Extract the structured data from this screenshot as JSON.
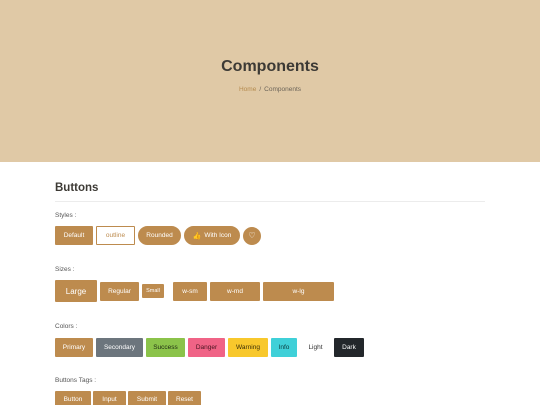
{
  "hero": {
    "title": "Components",
    "breadcrumb": {
      "home": "Home",
      "separator": "/",
      "current": "Components"
    }
  },
  "section": {
    "title": "Buttons"
  },
  "styles": {
    "label": "Styles :",
    "default": "Default",
    "outline": "outline",
    "rounded": "Rounded",
    "with_icon": "With Icon",
    "with_icon_glyph": "👍",
    "heart_glyph": "♡"
  },
  "sizes": {
    "label": "Sizes :",
    "large": "Large",
    "regular": "Regular",
    "small": "Small",
    "w_sm": "w-sm",
    "w_md": "w-md",
    "w_lg": "w-lg"
  },
  "colors": {
    "label": "Colors :",
    "items": [
      "Primary",
      "Secondary",
      "Success",
      "Danger",
      "Warning",
      "Info",
      "Light",
      "Dark"
    ],
    "accent": "#bd8b4e",
    "hero_bg": "#e0c9a6"
  },
  "tags": {
    "label": "Buttons Tags :",
    "items": [
      "Button",
      "Input",
      "Submit",
      "Reset"
    ]
  },
  "icons": {
    "with_icon": "thumbs-up-icon",
    "heart": "heart-icon"
  }
}
